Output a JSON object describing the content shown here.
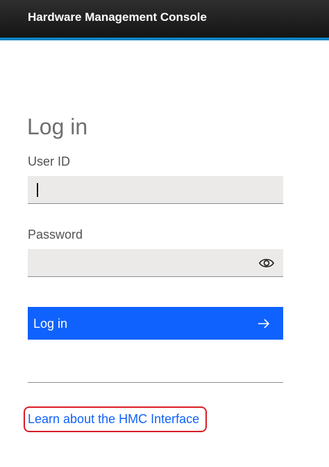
{
  "header": {
    "title": "Hardware Management Console"
  },
  "login": {
    "title": "Log in",
    "user_id_label": "User ID",
    "user_id_value": "",
    "password_label": "Password",
    "password_value": "",
    "password_toggle_icon": "eye-icon",
    "button_label": "Log in",
    "button_icon": "arrow-right-icon"
  },
  "links": {
    "learn_label": "Learn about the HMC Interface"
  },
  "colors": {
    "header_bg": "#1f1f1f",
    "header_accent": "#0f84c4",
    "primary": "#0f62fe",
    "highlight": "#da1e28"
  }
}
